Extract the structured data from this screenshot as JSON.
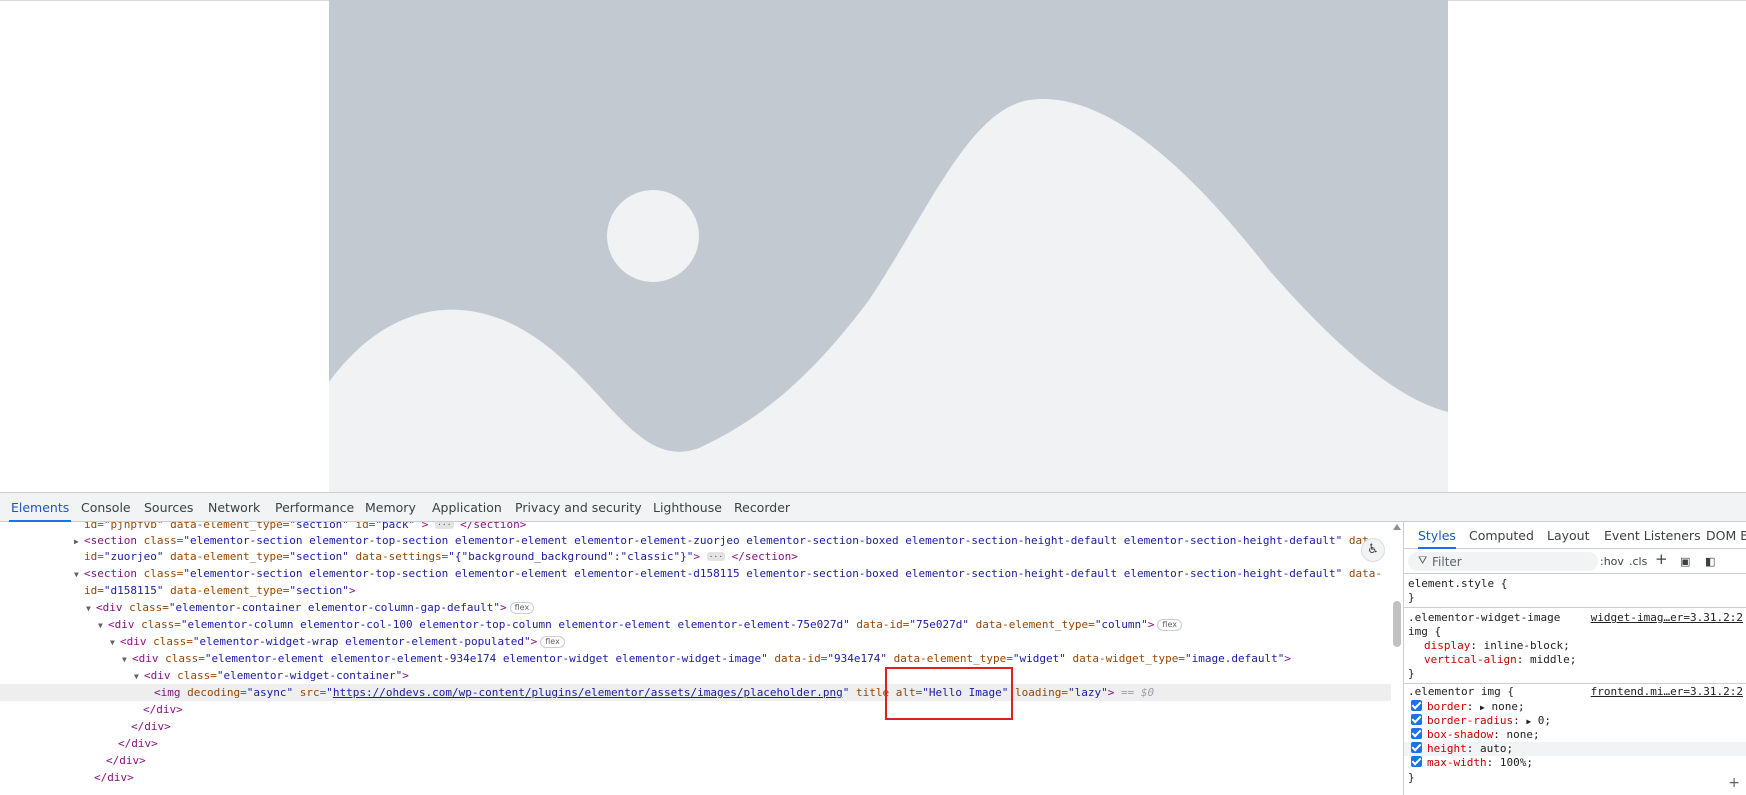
{
  "devtools": {
    "tabs": [
      "Elements",
      "Console",
      "Sources",
      "Network",
      "Performance",
      "Memory",
      "Application",
      "Privacy and security",
      "Lighthouse",
      "Recorder"
    ],
    "active_tab": "Elements"
  },
  "elements": {
    "l0": {
      "a": "id=\"pjnpfvb\"",
      "b": " data-element_type=",
      "c": "\"section\"",
      "d": " id=",
      "e": "\"pack\"",
      "f": "</section>"
    },
    "l1": {
      "tag": "<section",
      "an1": " class=",
      "av1": "\"elementor-section elementor-top-section elementor-element elementor-element-zuorjeo elementor-section-boxed elementor-section-height-default elementor-section-height-default\"",
      "an2": " dat"
    },
    "l2": {
      "an1": "id=",
      "av1": "\"zuorjeo\"",
      "an2": " data-element_type=",
      "av2": "\"section\"",
      "an3": " data-settings=",
      "av3": "\"{\"background_background\":\"classic\"}\"",
      "end": "</section>"
    },
    "l3": {
      "tag": "<section",
      "an1": " class=",
      "av1": "\"elementor-section elementor-top-section elementor-element elementor-element-d158115 elementor-section-boxed elementor-section-height-default elementor-section-height-default\"",
      "an2": " data-"
    },
    "l4": {
      "an1": "id=",
      "av1": "\"d158115\"",
      "an2": " data-element_type=",
      "av2": "\"section\"",
      "end": ">"
    },
    "l5": {
      "tag": "<div",
      "an1": " class=",
      "av1": "\"elementor-container elementor-column-gap-default\"",
      "end": ">",
      "badge": "flex"
    },
    "l6": {
      "tag": "<div",
      "an1": " class=",
      "av1": "\"elementor-column elementor-col-100 elementor-top-column elementor-element elementor-element-75e027d\"",
      "an2": " data-id=",
      "av2": "\"75e027d\"",
      "an3": " data-element_type=",
      "av3": "\"column\"",
      "end": ">",
      "badge": "flex"
    },
    "l7": {
      "tag": "<div",
      "an1": " class=",
      "av1": "\"elementor-widget-wrap elementor-element-populated\"",
      "end": ">",
      "badge": "flex"
    },
    "l8": {
      "tag": "<div",
      "an1": " class=",
      "av1": "\"elementor-element elementor-element-934e174 elementor-widget elementor-widget-image\"",
      "an2": " data-id=",
      "av2": "\"934e174\"",
      "an3": " data-element_type=",
      "av3": "\"widget\"",
      "an4": " data-widget_type=",
      "av4": "\"image.default\"",
      "end": ">"
    },
    "l9": {
      "tag": "<div",
      "an1": " class=",
      "av1": "\"elementor-widget-container\"",
      "end": ">"
    },
    "l10": {
      "tag": "<img",
      "an1": " decoding=",
      "av1": "\"async\"",
      "an2": " src=",
      "link": "https://ohdevs.com/wp-content/plugins/elementor/assets/images/placeholder.png",
      "an3": " title",
      "an4": " alt=",
      "av4": "\"Hello Image\"",
      "an5": " loading=",
      "av5": "\"lazy\"",
      "end": ">",
      "eq": " == $0"
    },
    "l11": "</div>",
    "l12": "</div>",
    "l13": "</div>",
    "l14": "</div>",
    "l15": "</div>"
  },
  "styles": {
    "subtabs": [
      "Styles",
      "Computed",
      "Layout",
      "Event Listeners",
      "DOM B"
    ],
    "active_subtab": "Styles",
    "filter_placeholder": "Filter",
    "tools": [
      ":hov",
      ".cls"
    ],
    "element_style": "element.style {",
    "close": "}",
    "rule1": {
      "selector1": ".elementor-widget-image",
      "selector2": "img {",
      "source": "widget-imag…er=3.31.2:2",
      "props": [
        {
          "name": "display",
          "value": "inline-block;"
        },
        {
          "name": "vertical-align",
          "value": "middle;"
        }
      ]
    },
    "rule2": {
      "selector": ".elementor img {",
      "source": "frontend.mi…er=3.31.2:2",
      "props": [
        {
          "name": "border",
          "arrow": "▶",
          "value": "none;"
        },
        {
          "name": "border-radius",
          "arrow": "▶",
          "value": "0;"
        },
        {
          "name": "box-shadow",
          "arrow": "",
          "value": "none;"
        },
        {
          "name": "height",
          "arrow": "",
          "value": "auto;"
        },
        {
          "name": "max-width",
          "arrow": "",
          "value": "100%;"
        }
      ]
    }
  },
  "colors": {
    "placeholder_bg": "#c2c9d0",
    "placeholder_fg": "#f0f2f4",
    "accent": "#1a73e8",
    "highlight": "#e02020"
  }
}
